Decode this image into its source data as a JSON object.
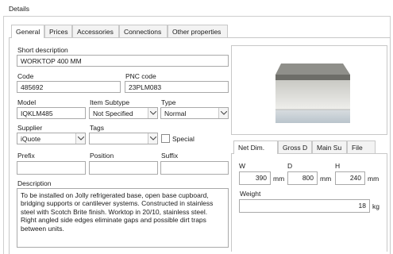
{
  "panel": {
    "title": "Details"
  },
  "tabs": [
    {
      "label": "General"
    },
    {
      "label": "Prices"
    },
    {
      "label": "Accessories"
    },
    {
      "label": "Connections"
    },
    {
      "label": "Other properties"
    }
  ],
  "general": {
    "short_description": {
      "label": "Short description",
      "value": "WORKTOP 400 MM"
    },
    "code": {
      "label": "Code",
      "value": "485692"
    },
    "pnc_code": {
      "label": "PNC code",
      "value": "23PLM083"
    },
    "model": {
      "label": "Model",
      "value": "IQKLM485"
    },
    "item_subtype": {
      "label": "Item Subtype",
      "value": "Not Specified"
    },
    "type": {
      "label": "Type",
      "value": "Normal"
    },
    "supplier": {
      "label": "Supplier",
      "value": "iQuote"
    },
    "tags": {
      "label": "Tags",
      "value": ""
    },
    "special": {
      "label": "Special",
      "checked": false
    },
    "prefix": {
      "label": "Prefix",
      "value": ""
    },
    "position": {
      "label": "Position",
      "value": ""
    },
    "suffix": {
      "label": "Suffix",
      "value": ""
    },
    "description": {
      "label": "Description",
      "lines": [
        "To be installed on Jolly refrigerated base, open base cupboard,",
        "bridging supports or cantilever systems. Constructed in stainless",
        "steel with Scotch Brite finish. Worktop in 20/10, stainless steel.",
        "Right angled side edges eliminate gaps and possible dirt traps",
        "between units."
      ]
    }
  },
  "dim_tabs": [
    {
      "label": "Net Dim."
    },
    {
      "label": "Gross D"
    },
    {
      "label": "Main Su"
    },
    {
      "label": "File"
    }
  ],
  "net_dim": {
    "w": {
      "label": "W",
      "value": "390",
      "unit": "mm"
    },
    "d": {
      "label": "D",
      "value": "800",
      "unit": "mm"
    },
    "h": {
      "label": "H",
      "value": "240",
      "unit": "mm"
    },
    "weight": {
      "label": "Weight",
      "value": "18",
      "unit": "kg"
    }
  },
  "colors": {
    "border": "#c8c8c8",
    "input_border": "#a9a9a9",
    "tab_bg": "#f3f3f3"
  },
  "icons": {
    "dropdown": "chevron-down-icon",
    "product": "worktop-image"
  }
}
